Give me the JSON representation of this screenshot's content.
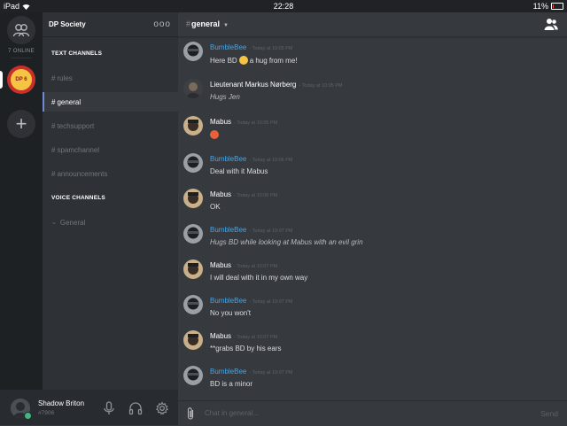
{
  "statusbar": {
    "device": "iPad",
    "time": "22:28",
    "battery": "11%"
  },
  "rail": {
    "online_label": "7 ONLINE",
    "server_badge": "DP 6"
  },
  "sidebar": {
    "server_name": "DP Society",
    "menu_glyph": "ooo",
    "text_category": "TEXT CHANNELS",
    "text_channels": [
      "rules",
      "general",
      "techsupport",
      "spamchannel",
      "announcements"
    ],
    "voice_category": "VOICE CHANNELS",
    "voice_channels": [
      "General"
    ]
  },
  "user": {
    "name": "Shadow Briton",
    "discriminator": "#7906"
  },
  "channel": {
    "hash": "#",
    "name": "general"
  },
  "messages": [
    {
      "author": "BumbleBee",
      "author_color": "#4aa3df",
      "time": "- Today at 10:05 PM",
      "text": "Here BD",
      "emoji": "hugging-face-emoji",
      "text_after": "a hug from me!",
      "italic": false
    },
    {
      "author": "Lieutenant Markus Nørberg",
      "author_color": "#ffffff",
      "time": "- Today at 10:05 PM",
      "text": "Hugs Jen",
      "italic": true
    },
    {
      "author": "Mabus",
      "author_color": "#ffffff",
      "time": "- Today at 10:05 PM",
      "text": "",
      "emoji": "angry-face-emoji",
      "italic": false
    },
    {
      "author": "BumbleBee",
      "author_color": "#4aa3df",
      "time": "- Today at 10:06 PM",
      "text": "Deal with it Mabus",
      "italic": false
    },
    {
      "author": "Mabus",
      "author_color": "#ffffff",
      "time": "- Today at 10:06 PM",
      "text": "OK",
      "italic": false
    },
    {
      "author": "BumbleBee",
      "author_color": "#4aa3df",
      "time": "- Today at 10:07 PM",
      "text": "Hugs BD while looking at Mabus with an evil grin",
      "italic": true
    },
    {
      "author": "Mabus",
      "author_color": "#ffffff",
      "time": "- Today at 10:07 PM",
      "text": "I will deal with it in my own way",
      "italic": false
    },
    {
      "author": "BumbleBee",
      "author_color": "#4aa3df",
      "time": "- Today at 10:07 PM",
      "text": "No you won't",
      "italic": false
    },
    {
      "author": "Mabus",
      "author_color": "#ffffff",
      "time": "- Today at 10:07 PM",
      "text": "**grabs BD by his ears",
      "italic": false
    },
    {
      "author": "BumbleBee",
      "author_color": "#4aa3df",
      "time": "- Today at 10:07 PM",
      "text": "BD is a minor",
      "italic": false
    }
  ],
  "composer": {
    "placeholder": "Chat in general...",
    "send_label": "Send"
  },
  "colors": {
    "accent": "#7289da",
    "online": "#43b581",
    "author_blue": "#4aa3df"
  }
}
